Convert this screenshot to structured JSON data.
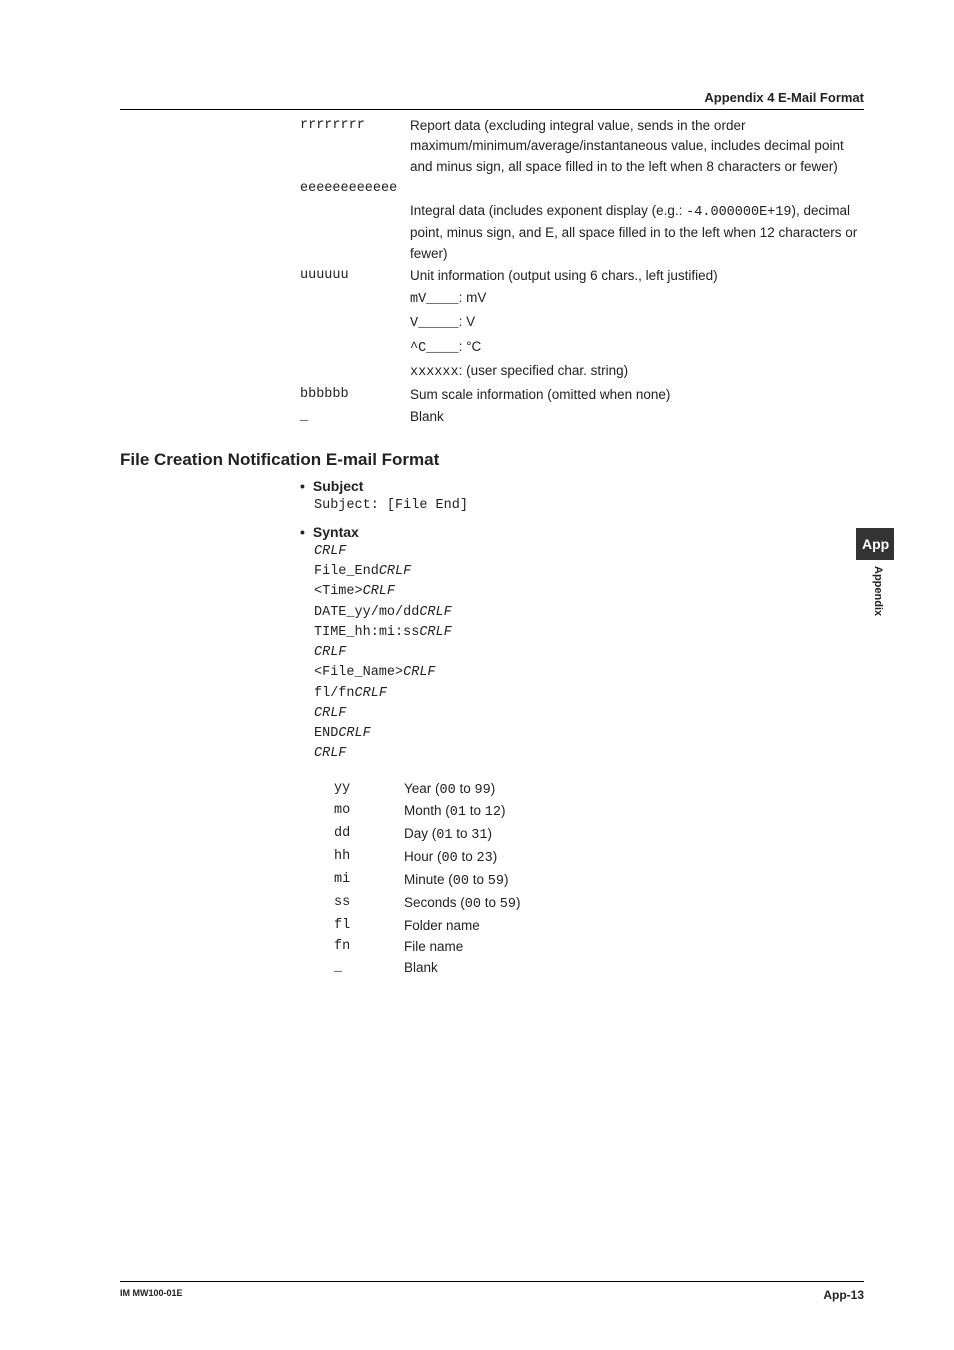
{
  "header": {
    "title": "Appendix 4  E-Mail Format"
  },
  "defs": {
    "r_code": "rrrrrrrr",
    "r_desc": "Report data (excluding integral value, sends in the order maximum/minimum/average/instantaneous value, includes decimal point and minus sign, all space filled in to the left when 8 characters or fewer)",
    "e_code": "eeeeeeeeeeee",
    "e_desc_pre": "Integral data (includes exponent display (e.g.: ",
    "e_desc_val": "-4.000000E+19",
    "e_desc_post": "), decimal point, minus sign, and E, all space filled in to the left when 12 characters or fewer)",
    "u_code": "uuuuuu",
    "u_desc": "Unit information (output using 6 chars., left justified)",
    "u_ex1_code": "mV____",
    "u_ex1_sep": ": mV",
    "u_ex2_code": "V_____",
    "u_ex2_sep": ": V",
    "u_ex3_code": "^C____",
    "u_ex3_sep": ": °C",
    "u_ex4_code": "xxxxxx",
    "u_ex4_sep": ": (user specified char. string)",
    "b_code": "bbbbbb",
    "b_desc": "Sum scale information (omitted when none)",
    "blank_code": "_",
    "blank_desc": "Blank"
  },
  "section_heading": "File Creation Notification E-mail Format",
  "subject": {
    "head": "Subject",
    "line_pre": "Subject: ",
    "line_val": "[File End]"
  },
  "syntax": {
    "head": "Syntax",
    "l1": "CRLF",
    "l2a": "File_End",
    "l2b": "CRLF",
    "l3a": "<Time>",
    "l3b": "CRLF",
    "l4a": "DATE_",
    "l4b": "yy/mo/dd",
    "l4c": "CRLF",
    "l5a": "TIME_",
    "l5b": "hh:mi:ss",
    "l5c": "CRLF",
    "l6": "CRLF",
    "l7a": "<File_Name>",
    "l7b": "CRLF",
    "l8a": "fl/fn",
    "l8b": "CRLF",
    "l9": "CRLF",
    "l10a": "END",
    "l10b": "CRLF",
    "l11": "CRLF"
  },
  "params": {
    "yy_c": "yy",
    "yy_d_pre": "Year (",
    "yy_d_r1": "00",
    "yy_d_mid": " to ",
    "yy_d_r2": "99",
    "yy_d_post": ")",
    "mo_c": "mo",
    "mo_d_pre": "Month (",
    "mo_d_r1": "01",
    "mo_d_mid": " to ",
    "mo_d_r2": "12",
    "mo_d_post": ")",
    "dd_c": "dd",
    "dd_d_pre": "Day (",
    "dd_d_r1": "01",
    "dd_d_mid": " to ",
    "dd_d_r2": "31",
    "dd_d_post": ")",
    "hh_c": "hh",
    "hh_d_pre": "Hour (",
    "hh_d_r1": "00",
    "hh_d_mid": " to ",
    "hh_d_r2": "23",
    "hh_d_post": ")",
    "mi_c": "mi",
    "mi_d_pre": "Minute (",
    "mi_d_r1": "00",
    "mi_d_mid": " to ",
    "mi_d_r2": "59",
    "mi_d_post": ")",
    "ss_c": "ss",
    "ss_d_pre": "Seconds (",
    "ss_d_r1": "00",
    "ss_d_mid": " to ",
    "ss_d_r2": "59",
    "ss_d_post": ")",
    "fl_c": "fl",
    "fl_d": "Folder name",
    "fn_c": "fn",
    "fn_d": "File name",
    "bl_c": "_",
    "bl_d": "Blank"
  },
  "sidebar": {
    "tab": "App",
    "label": "Appendix"
  },
  "footer": {
    "left": "IM MW100-01E",
    "right": "App-13"
  }
}
